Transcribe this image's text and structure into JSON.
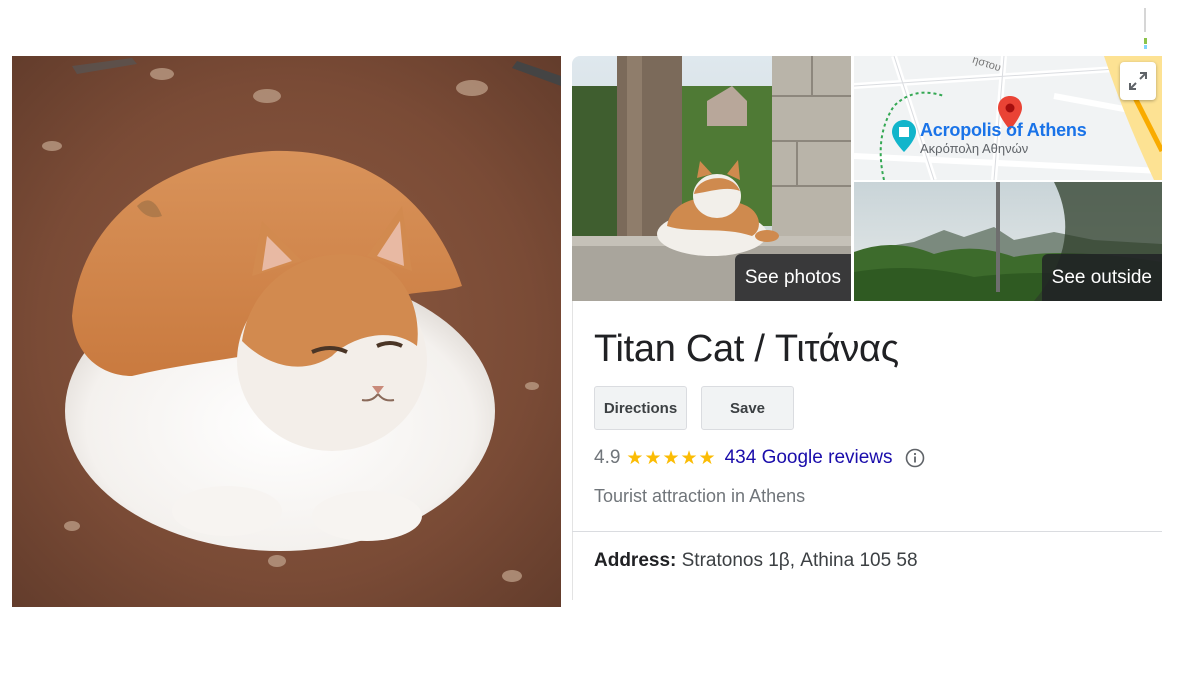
{
  "hero_photo": {
    "alt": "Orange and white cat lying on dirt"
  },
  "gallery": {
    "see_photos_label": "See photos",
    "see_outside_label": "See outside",
    "map": {
      "place_name": "Acropolis of Athens",
      "place_name_local": "Ακρόπολη Αθηνών",
      "street_fragment": "ηστου"
    }
  },
  "place": {
    "title": "Titan Cat / Τιτάνας",
    "rating": "4.9",
    "stars": "★★★★★",
    "reviews_link": "434 Google reviews",
    "category": "Tourist attraction in Athens",
    "address_label": "Address:",
    "address_value": " Stratonos 1β, Athina 105 58"
  },
  "actions": {
    "directions_label": "Directions",
    "save_label": "Save"
  },
  "colors": {
    "link": "#1a0dab",
    "star": "#fbbc04",
    "map_pin": "#ea4335",
    "map_label": "#1a73e8"
  }
}
